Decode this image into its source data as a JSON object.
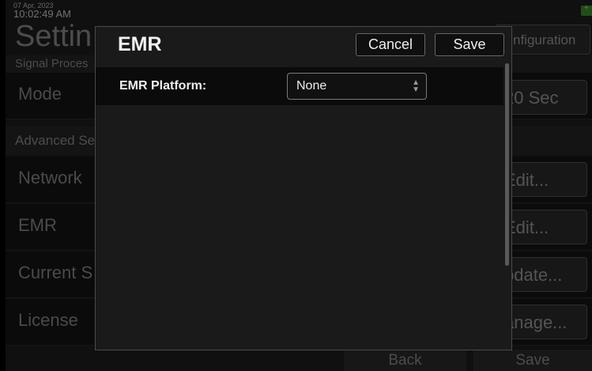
{
  "status": {
    "date": "07 Apr, 2023",
    "time": "10:02:49 AM"
  },
  "page": {
    "title": "Settin",
    "configuration_button": "nfiguration",
    "section_signal": "Signal Proces",
    "section_advanced": "Advanced Se",
    "rows": [
      {
        "label": "Mode",
        "button": "20 Sec"
      },
      {
        "label": "Network",
        "button": "Edit..."
      },
      {
        "label": "EMR",
        "button": "Edit..."
      },
      {
        "label": "Current S",
        "button": "pdate..."
      },
      {
        "label": "License",
        "button": "anage..."
      }
    ],
    "back_button": "Back",
    "save_button": "Save"
  },
  "dialog": {
    "title": "EMR",
    "cancel_label": "Cancel",
    "save_label": "Save",
    "field_label": "EMR Platform:",
    "field_value": "None"
  },
  "icons": {
    "select_arrows": "up-down-chevron-icon",
    "battery": "battery-charging-icon"
  },
  "colors": {
    "battery": "#3c8c2e",
    "dialog_bg": "#1a1a1a"
  }
}
